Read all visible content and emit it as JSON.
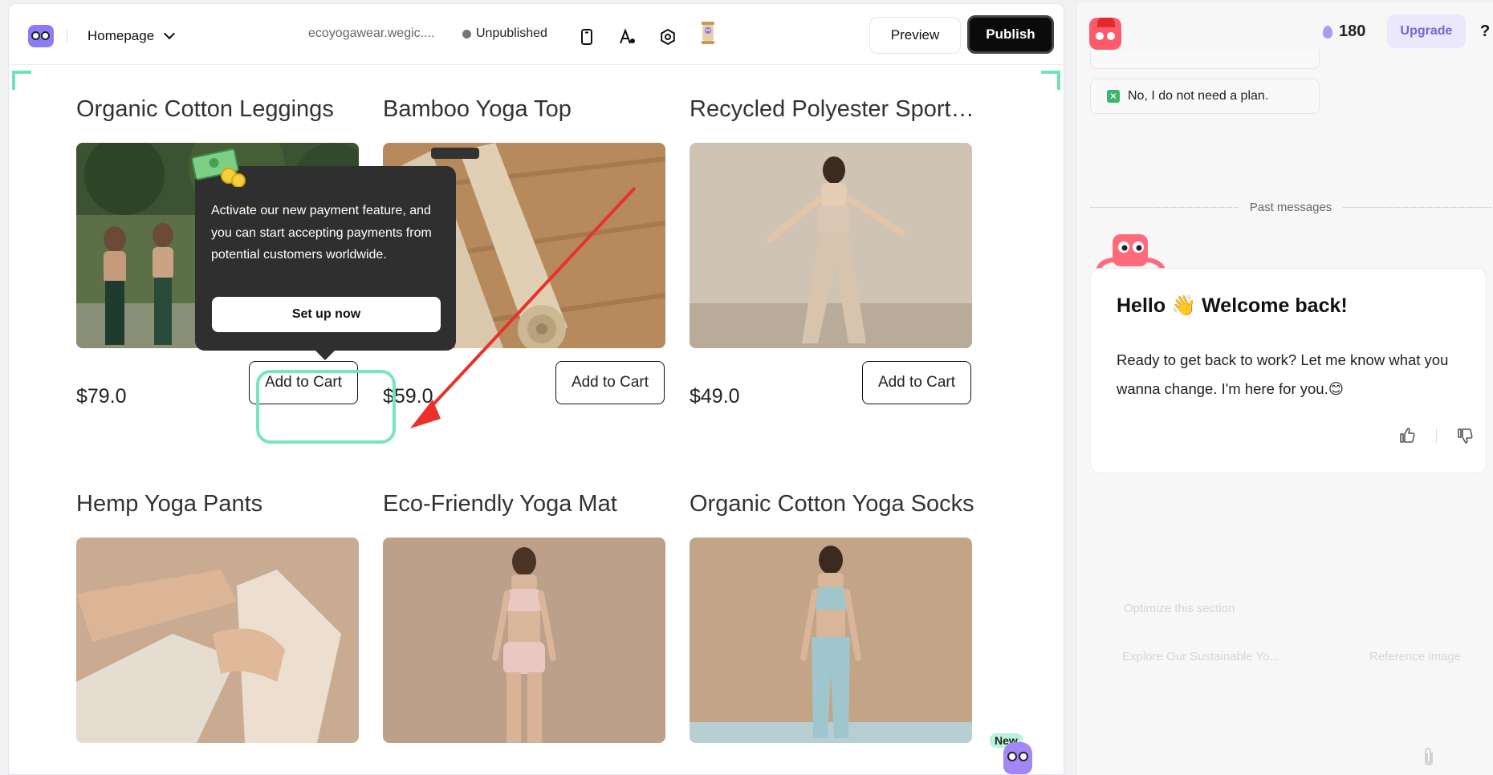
{
  "topbar": {
    "page_name": "Homepage",
    "domain": "ecoyogawear.wegic....",
    "status": "Unpublished",
    "preview_label": "Preview",
    "publish_label": "Publish"
  },
  "products": [
    {
      "name": "Organic Cotton Leggings",
      "price": "$79.0",
      "cart_label": "Add to Cart"
    },
    {
      "name": "Bamboo Yoga Top",
      "price": "$59.0",
      "cart_label": "Add to Cart"
    },
    {
      "name": "Recycled Polyester Sports...",
      "price": "$49.0",
      "cart_label": "Add to Cart"
    },
    {
      "name": "Hemp Yoga Pants"
    },
    {
      "name": "Eco-Friendly Yoga Mat"
    },
    {
      "name": "Organic Cotton Yoga Socks"
    }
  ],
  "tooltip": {
    "text": "Activate our new payment feature, and you can start accepting payments from potential customers worldwide.",
    "button_label": "Set up now"
  },
  "badge": {
    "new_label": "New"
  },
  "chat": {
    "credits": "180",
    "upgrade_label": "Upgrade",
    "help_label": "?",
    "plan_option": "No, I do not need a plan.",
    "divider": "Past messages",
    "greeting": "Hello 👋 Welcome back!",
    "message": "Ready to get back to work? Let me know what you wanna change. I'm here for you.😊",
    "ghost_1": "Optimize this section",
    "ghost_2": "Explore Our Sustainable Yo...",
    "ghost_3": "Reference image"
  },
  "colors": {
    "accent_green": "#77e6be",
    "brand_purple": "#8b7cf6",
    "publish_bg": "#0b0b0b",
    "arrow_red": "#e8322b"
  }
}
